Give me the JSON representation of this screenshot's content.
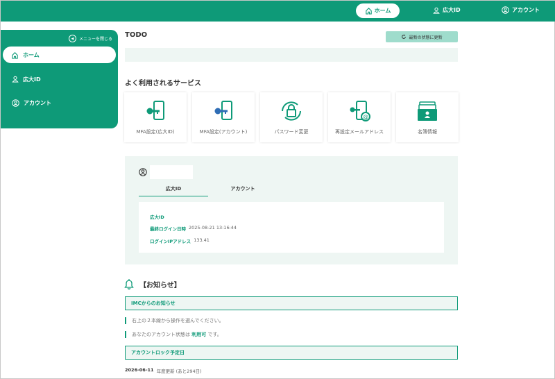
{
  "topbar": {
    "home_label": "ホーム",
    "univ_id_label": "広大ID",
    "account_label": "アカウント"
  },
  "sidebar": {
    "close_label": "メニューを閉じる",
    "items": [
      {
        "label": "ホーム",
        "icon": "home-icon",
        "active": true
      },
      {
        "label": "広大ID",
        "icon": "user-icon",
        "active": false
      },
      {
        "label": "アカウント",
        "icon": "user-circle-icon",
        "active": false
      }
    ]
  },
  "todo": {
    "title": "TODO",
    "refresh_label": "最新の状態に更新"
  },
  "services": {
    "title": "よく利用されるサービス",
    "items": [
      {
        "label": "MFA設定(広大ID)",
        "icon": "phone-key-green-icon"
      },
      {
        "label": "MFA設定(アカウント)",
        "icon": "phone-key-blue-icon"
      },
      {
        "label": "パスワード変更",
        "icon": "lock-refresh-icon"
      },
      {
        "label": "再設定メールアドレス",
        "icon": "phone-key-mail-icon"
      },
      {
        "label": "名簿情報",
        "icon": "card-box-icon"
      }
    ]
  },
  "account": {
    "tabs": [
      "広大ID",
      "アカウント"
    ],
    "rows": [
      {
        "key": "広大ID",
        "value": ""
      },
      {
        "key": "最終ログイン日時",
        "value": "2025-08-21 13:16:44"
      },
      {
        "key": "ログインIPアドレス",
        "value": "133.41"
      }
    ]
  },
  "notices": {
    "title": "【お知らせ】",
    "imc_title": "IMCからのお知らせ",
    "bullet1": "右上の２本線から操作を選んでください。",
    "bullet2_pre": "あなたのアカウント状態は",
    "bullet2_status": "利用可",
    "bullet2_post": "です。",
    "lock_title": "アカウントロック予定日",
    "lock_date": "2026-06-11",
    "lock_desc": "年度更新 (あと294日)"
  },
  "colors": {
    "primary": "#0e9a78",
    "light_bg": "#eef6f3",
    "refresh_bg": "#9fdccc"
  }
}
